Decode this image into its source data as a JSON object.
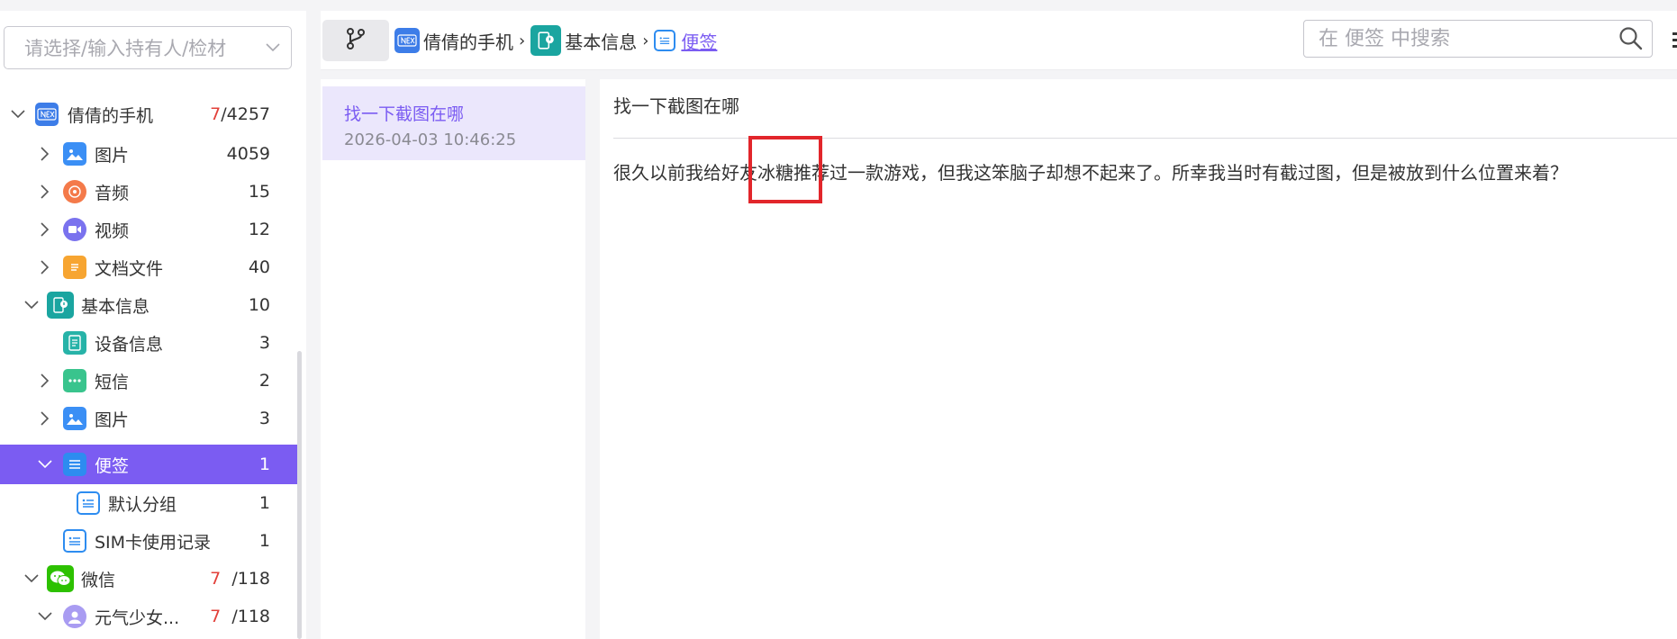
{
  "sidebar": {
    "holder_placeholder": "请选择/输入持有人/检材",
    "items": [
      {
        "label": "倩倩的手机",
        "count_red": "7",
        "count": "/4257",
        "expanded": true
      },
      {
        "label": "图片",
        "count": "4059"
      },
      {
        "label": "音频",
        "count": "15"
      },
      {
        "label": "视频",
        "count": "12"
      },
      {
        "label": "文档文件",
        "count": "40"
      },
      {
        "label": "基本信息",
        "count": "10",
        "expanded": true
      },
      {
        "label": "设备信息",
        "count": "3"
      },
      {
        "label": "短信",
        "count": "2"
      },
      {
        "label": "图片",
        "count": "3"
      },
      {
        "label": "便签",
        "count": "1",
        "selected": true,
        "expanded": true
      },
      {
        "label": "默认分组",
        "count": "1"
      },
      {
        "label": "SIM卡使用记录",
        "count": "1"
      },
      {
        "label": "微信",
        "count_red": "7",
        "count": "/118",
        "expanded": true
      },
      {
        "label": "元气少女...",
        "count_red": "7",
        "count": "/118",
        "expanded": true
      }
    ]
  },
  "toolbar": {
    "breadcrumbs": [
      "倩倩的手机",
      "基本信息",
      "便签"
    ],
    "separator": "›",
    "search_placeholder": "在 便签 中搜索"
  },
  "notes": {
    "items": [
      {
        "title": "找一下截图在哪",
        "time": "2026-04-03 10:46:25"
      }
    ]
  },
  "detail": {
    "title": "找一下截图在哪",
    "body": "很久以前我给好友冰糖推荐过一款游戏，但我这笨脑子却想不起来了。所幸我当时有截过图，但是被放到什么位置来着？"
  },
  "colors": {
    "accent": "#7b5cf2",
    "highlight": "#e2262b",
    "count_red": "#e2403a"
  }
}
